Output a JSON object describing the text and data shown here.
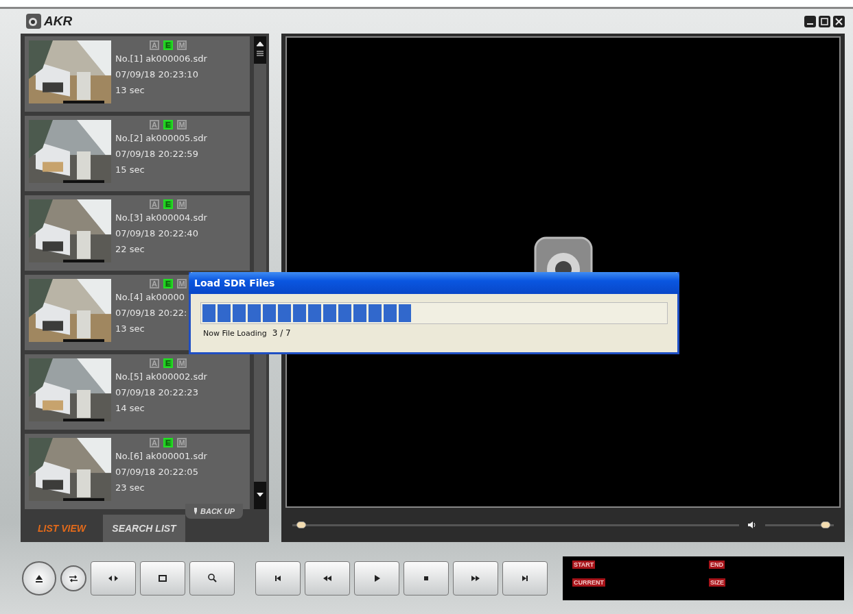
{
  "app": {
    "title": "AKR"
  },
  "recordings": [
    {
      "name": "No.[1] ak000006.sdr",
      "datetime": "07/09/18 20:23:10",
      "duration": "13 sec",
      "flags": [
        {
          "label": "A",
          "on": false
        },
        {
          "label": "E",
          "on": true
        },
        {
          "label": "M",
          "on": false
        }
      ]
    },
    {
      "name": "No.[2] ak000005.sdr",
      "datetime": "07/09/18 20:22:59",
      "duration": "15 sec",
      "flags": [
        {
          "label": "A",
          "on": false
        },
        {
          "label": "E",
          "on": true
        },
        {
          "label": "M",
          "on": false
        }
      ]
    },
    {
      "name": "No.[3] ak000004.sdr",
      "datetime": "07/09/18 20:22:40",
      "duration": "22 sec",
      "flags": [
        {
          "label": "A",
          "on": false
        },
        {
          "label": "E",
          "on": true
        },
        {
          "label": "M",
          "on": false
        }
      ]
    },
    {
      "name": "No.[4] ak00000",
      "datetime": "07/09/18 20:22:",
      "duration": "13 sec",
      "flags": [
        {
          "label": "A",
          "on": false
        },
        {
          "label": "E",
          "on": true
        },
        {
          "label": "M",
          "on": false
        }
      ]
    },
    {
      "name": "No.[5] ak000002.sdr",
      "datetime": "07/09/18 20:22:23",
      "duration": "14 sec",
      "flags": [
        {
          "label": "A",
          "on": false
        },
        {
          "label": "E",
          "on": true
        },
        {
          "label": "M",
          "on": false
        }
      ]
    },
    {
      "name": "No.[6] ak000001.sdr",
      "datetime": "07/09/18 20:22:05",
      "duration": "23 sec",
      "flags": [
        {
          "label": "A",
          "on": false
        },
        {
          "label": "E",
          "on": true
        },
        {
          "label": "M",
          "on": false
        }
      ]
    }
  ],
  "tabs": [
    {
      "label": "LIST VIEW",
      "selected": true
    },
    {
      "label": "SEARCH LIST",
      "selected": false
    }
  ],
  "backup_button": {
    "label": "BACK UP"
  },
  "player": {
    "position": {
      "level": 0.02
    },
    "volume": {
      "level": 0.88
    }
  },
  "info_panel": {
    "fields": [
      "START",
      "END",
      "CURRENT",
      "SIZE"
    ]
  },
  "dialog": {
    "title": "Load SDR Files",
    "progress": {
      "level": 0.45
    },
    "status": "Now File Loading",
    "count": "3 / 7"
  }
}
